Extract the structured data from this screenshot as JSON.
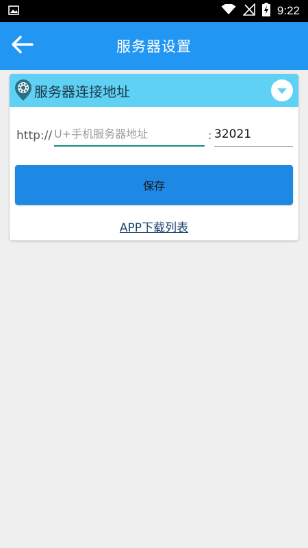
{
  "status_bar": {
    "time": "9:22",
    "icons": [
      "image-icon",
      "wifi-icon",
      "no-signal-icon",
      "battery-charging-icon"
    ]
  },
  "app_bar": {
    "title": "服务器设置",
    "back_icon": "back-arrow-icon"
  },
  "card": {
    "title": "服务器连接地址",
    "header_color": "#5fd1f5",
    "icons": [
      "gear-icon",
      "chevron-down-icon"
    ]
  },
  "form": {
    "protocol_label": "http://",
    "host_placeholder": "U+手机服务器地址",
    "host_value": "",
    "separator": ":",
    "port_value": "32021"
  },
  "actions": {
    "save_label": "保存",
    "download_link": "APP下载列表"
  },
  "colors": {
    "primary": "#2196f3",
    "button": "#1e88e5",
    "underline_active": "#13897f",
    "background": "#efefef"
  }
}
